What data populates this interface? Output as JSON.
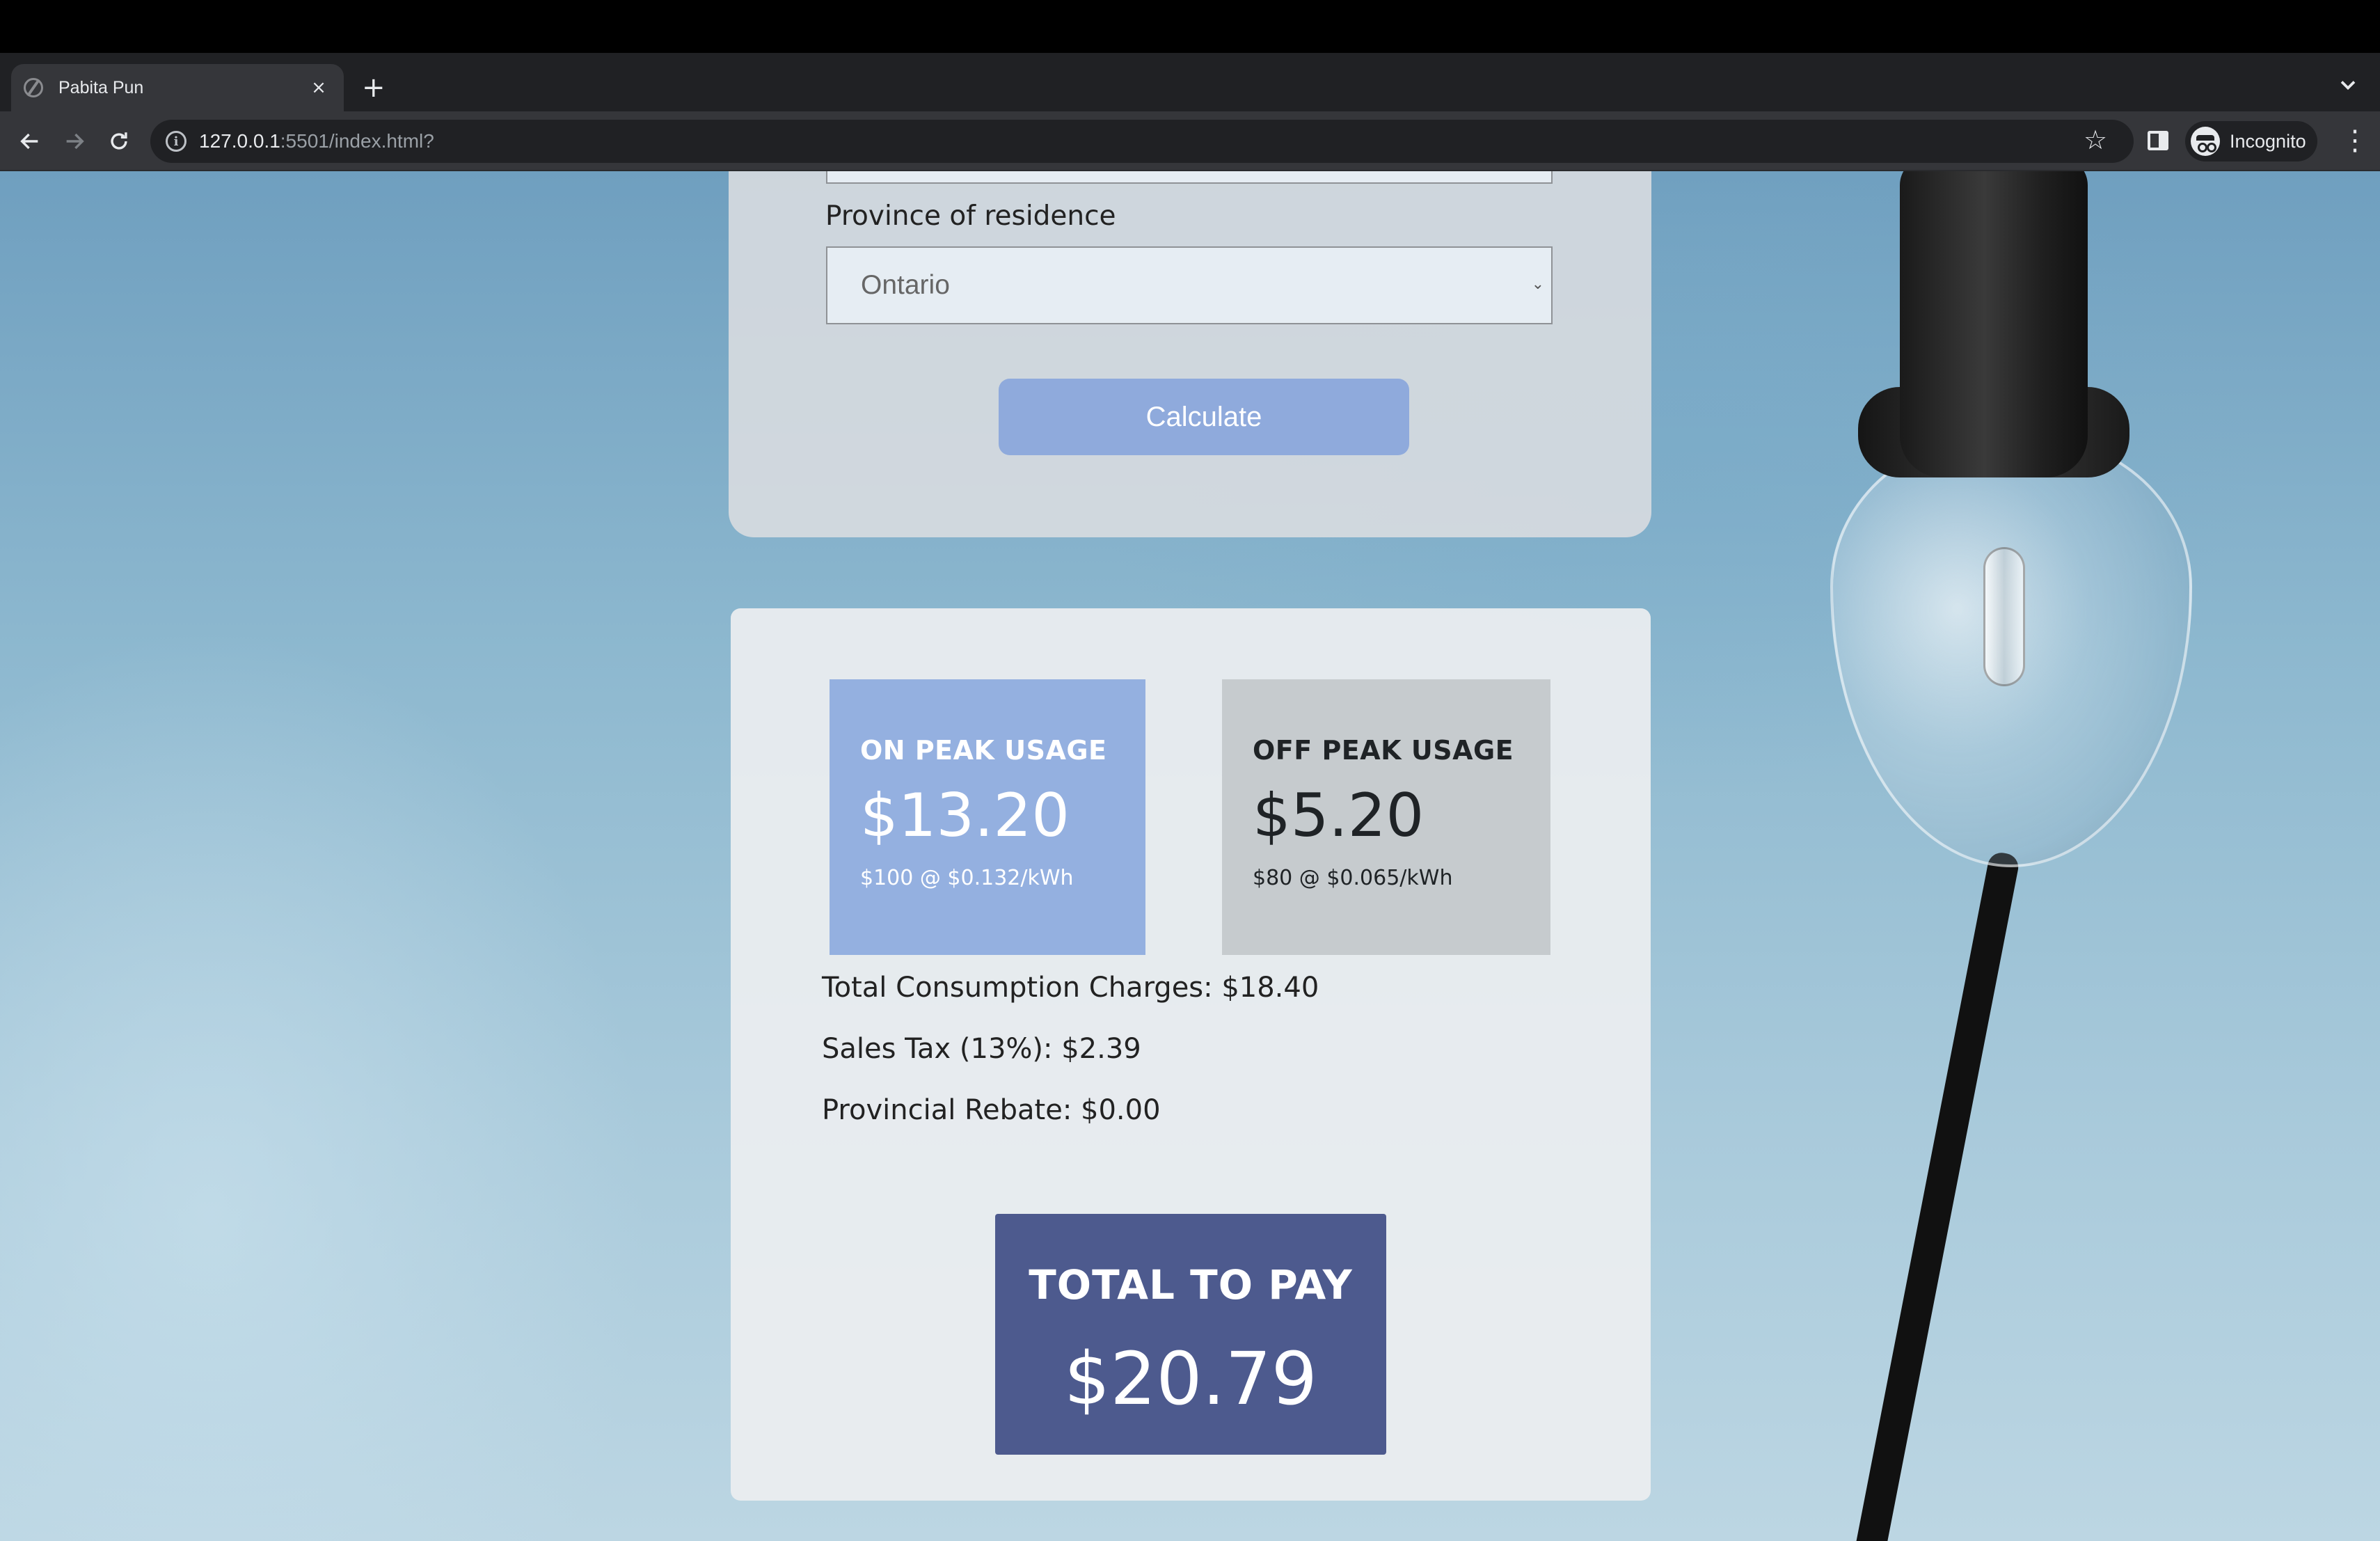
{
  "browser": {
    "tab_title": "Pabita Pun",
    "tab_close": "×",
    "new_tab": "+",
    "url_host": "127.0.0.1",
    "url_path": ":5501/index.html?",
    "profile_label": "Incognito",
    "icons": [
      "globe-icon",
      "close-icon",
      "plus-icon",
      "chevron-down-icon",
      "back-icon",
      "forward-icon",
      "reload-icon",
      "info-icon",
      "star-icon",
      "side-panel-icon",
      "incognito-icon",
      "more-vert-icon"
    ]
  },
  "form": {
    "province_label": "Province of residence",
    "province_value": "Ontario",
    "calculate_label": "Calculate"
  },
  "results": {
    "on_peak": {
      "title": "ON PEAK USAGE",
      "amount": "$13.20",
      "detail": "$100 @ $0.132/kWh"
    },
    "off_peak": {
      "title": "OFF PEAK USAGE",
      "amount": "$5.20",
      "detail": "$80 @ $0.065/kWh"
    },
    "total_consumption": "Total Consumption Charges: $18.40",
    "sales_tax": "Sales Tax (13%): $2.39",
    "provincial_rebate": "Provincial Rebate: $0.00",
    "total_title": "TOTAL TO PAY",
    "total_amount": "$20.79"
  },
  "colors": {
    "on_peak_bg": "#94b0e0",
    "off_peak_bg": "#c6cbce",
    "total_bg": "#4d5a8e",
    "calculate_bg": "#8faadc"
  }
}
